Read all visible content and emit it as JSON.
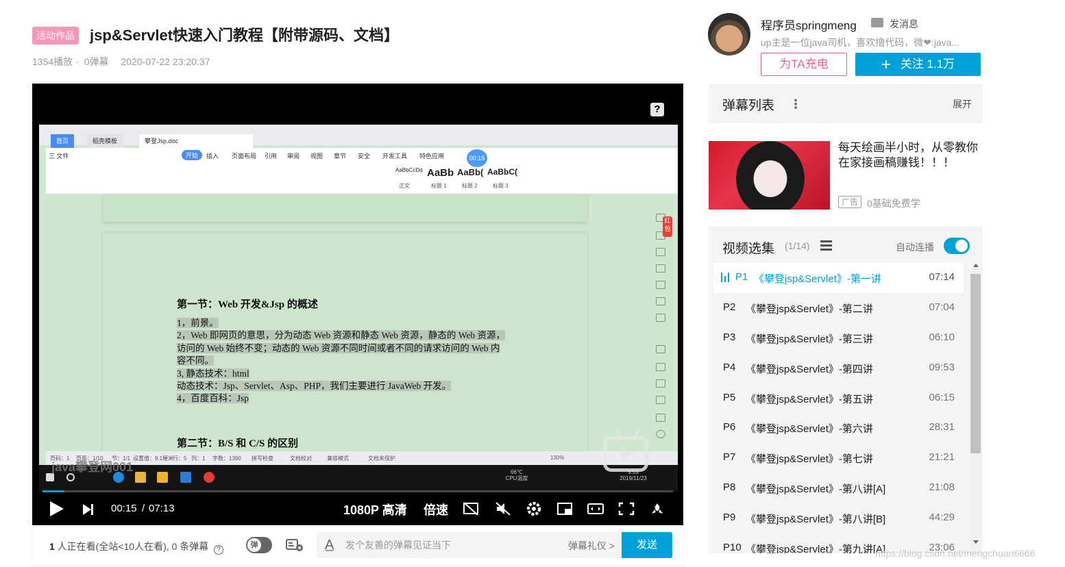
{
  "header": {
    "badge": "活动作品",
    "title": "jsp&Servlet快速入门教程【附带源码、文档】",
    "plays": "1354播放",
    "danmaku_count": "0弹幕",
    "date": "2020-07-22 23:20:37"
  },
  "player": {
    "help": "?",
    "current_time": "00:15",
    "separator": "/",
    "duration": "07:13",
    "progress": 0.035,
    "quality": "1080P 高清",
    "speed": "倍速",
    "accent": "#00a1d6"
  },
  "screen": {
    "tabs": [
      "首页",
      "稻壳模板",
      "攀登Jsp.doc"
    ],
    "menus": [
      "三 文件",
      "开始",
      "插入",
      "页面布局",
      "引用",
      "审阅",
      "视图",
      "章节",
      "安全",
      "开发工具",
      "特色应用"
    ],
    "styles": [
      {
        "sample": "AaBbCcDd",
        "name": "正文"
      },
      {
        "sample": "AaBb",
        "name": "标题 1"
      },
      {
        "sample": "AaBb(",
        "name": "标题 2"
      },
      {
        "sample": "AaBbC(",
        "name": "标题 3"
      }
    ],
    "timer": "00:15",
    "red_tab": "红包",
    "doc_heading1": "第一节：Web 开发&Jsp 的概述",
    "doc_lines": [
      "1，前景。",
      "2，Web 即网页的意思，分为动态 Web 资源和静态 Web 资源，静态的 Web 资源，",
      "访问的 Web 始终不变；动态的 Web 资源不同时间或者不同的请求访问的 Web 内",
      "容不同。",
      "3, 静态技术：html",
      "动态技术：Jsp、Servlet、Asp、PHP，我们主要进行 JavaWeb 开发。",
      "4，百度百科：Jsp"
    ],
    "doc_heading2": "第二节：B/S 和 C/S 的区别",
    "status_items": [
      "页码：1",
      "页面：1/10",
      "节：1/1",
      "设置值：9.1厘米",
      "行：5",
      "列：1",
      "字数：1390",
      "拼写检查",
      "文档校对",
      "兼容模式",
      "文档未保护"
    ],
    "zoom": "130%",
    "watermark": "java攀登网001",
    "cpu_temp": "66℃",
    "cpu_label": "CPU温度",
    "tray_time": "9:59",
    "tray_date": "2019/11/23"
  },
  "danmaku_bar": {
    "viewer_count": "1",
    "viewers_text": " 人正在看(全站<10人在看), 0 条弹幕",
    "toggle_label": "弹",
    "placeholder": "发个友善的弹幕见证当下",
    "etiquette": "弹幕礼仪 >",
    "send": "发送"
  },
  "uploader": {
    "name": "程序员springmeng",
    "message": "发消息",
    "desc": "up主是一位java司机，喜欢撸代码，微❤:java...",
    "charge": "为TA充电",
    "follow": "关注 1.1万"
  },
  "danmaku_list": {
    "title": "弹幕列表",
    "expand": "展开"
  },
  "ad": {
    "title": "每天绘画半小时，从零教你在家接画稿赚钱！！！",
    "badge": "广告",
    "sub": "0基础免费学"
  },
  "playlist": {
    "title": "视频选集",
    "count": "(1/14)",
    "autoplay": "自动连播",
    "items": [
      {
        "num": "P1",
        "name": "《攀登jsp&Servlet》-第一讲",
        "duration": "07:14",
        "active": true
      },
      {
        "num": "P2",
        "name": "《攀登jsp&Servlet》-第二讲",
        "duration": "07:04"
      },
      {
        "num": "P3",
        "name": "《攀登jsp&Servlet》-第三讲",
        "duration": "06:10"
      },
      {
        "num": "P4",
        "name": "《攀登jsp&Servlet》-第四讲",
        "duration": "09:53"
      },
      {
        "num": "P5",
        "name": "《攀登jsp&Servlet》-第五讲",
        "duration": "06:15"
      },
      {
        "num": "P6",
        "name": "《攀登jsp&Servlet》-第六讲",
        "duration": "28:31"
      },
      {
        "num": "P7",
        "name": "《攀登jsp&Servlet》-第七讲",
        "duration": "21:21"
      },
      {
        "num": "P8",
        "name": "《攀登jsp&Servlet》-第八讲[A]",
        "duration": "21:08"
      },
      {
        "num": "P9",
        "name": "《攀登jsp&Servlet》-第八讲[B]",
        "duration": "44:29"
      },
      {
        "num": "P10",
        "name": "《攀登jsp&Servlet》-第九讲[A]",
        "duration": "23:06"
      }
    ]
  },
  "watermark": "https://blog.csdn.net/mengchuan6666"
}
